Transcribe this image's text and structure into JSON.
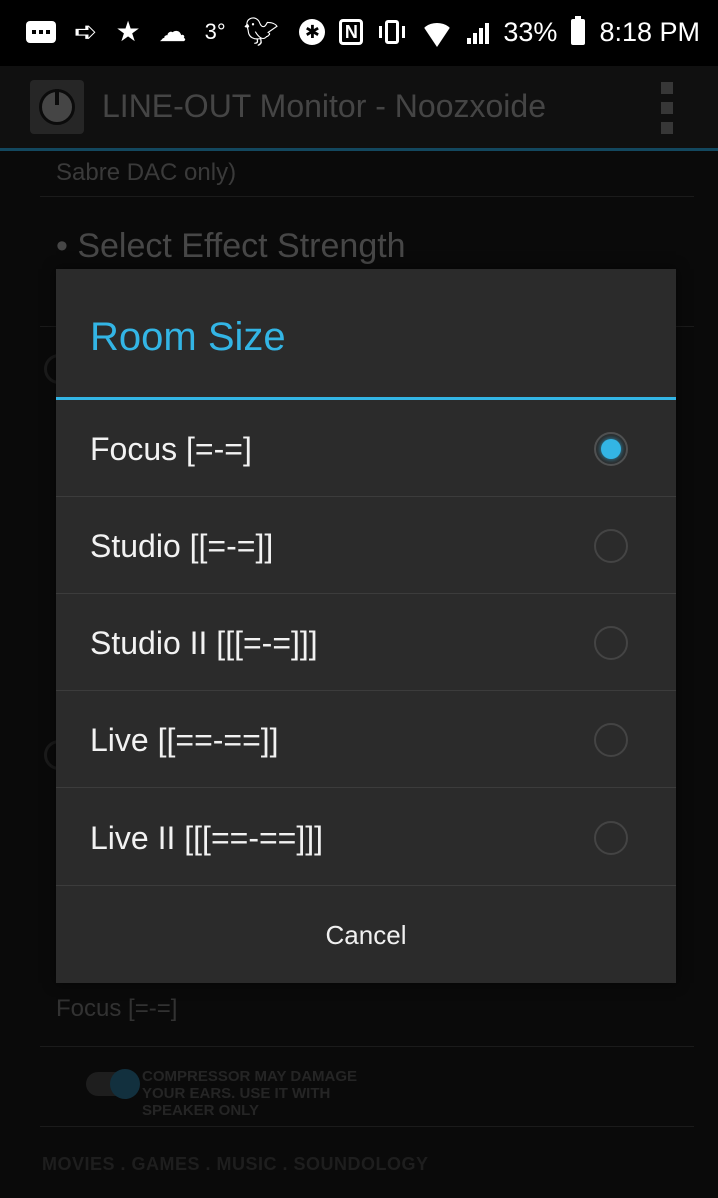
{
  "status_bar": {
    "temperature": "3°",
    "battery_percent": "33%",
    "time": "8:18 PM",
    "icons": [
      "message-icon",
      "send-icon",
      "star-icon",
      "cloud-icon",
      "twitter-icon",
      "bluetooth-icon",
      "nfc-icon",
      "vibrate-icon",
      "wifi-icon",
      "signal-icon",
      "battery-icon"
    ]
  },
  "action_bar": {
    "title": "LINE-OUT Monitor - Noozxoide",
    "overflow_icon": "overflow-menu-icon"
  },
  "background": {
    "sabre_text": "Sabre DAC only)",
    "select_effect": "• Select Effect Strength",
    "current_room": "Focus [=-=]",
    "compressor_warning": "COMPRESSOR MAY DAMAGE YOUR EARS. USE IT WITH SPEAKER ONLY",
    "footer": "MOVIES . GAMES . MUSIC . SOUNDOLOGY"
  },
  "dialog": {
    "title": "Room Size",
    "options": [
      {
        "label": "Focus [=-=]",
        "checked": true
      },
      {
        "label": "Studio [[=-=]]",
        "checked": false
      },
      {
        "label": "Studio II [[[=-=]]]",
        "checked": false
      },
      {
        "label": "Live [[==-==]]",
        "checked": false
      },
      {
        "label": "Live II [[[==-==]]]",
        "checked": false
      }
    ],
    "cancel_label": "Cancel"
  },
  "colors": {
    "accent": "#33b5e5",
    "dialog_bg": "#2b2b2b",
    "action_bar_divider": "#1e6f93"
  }
}
